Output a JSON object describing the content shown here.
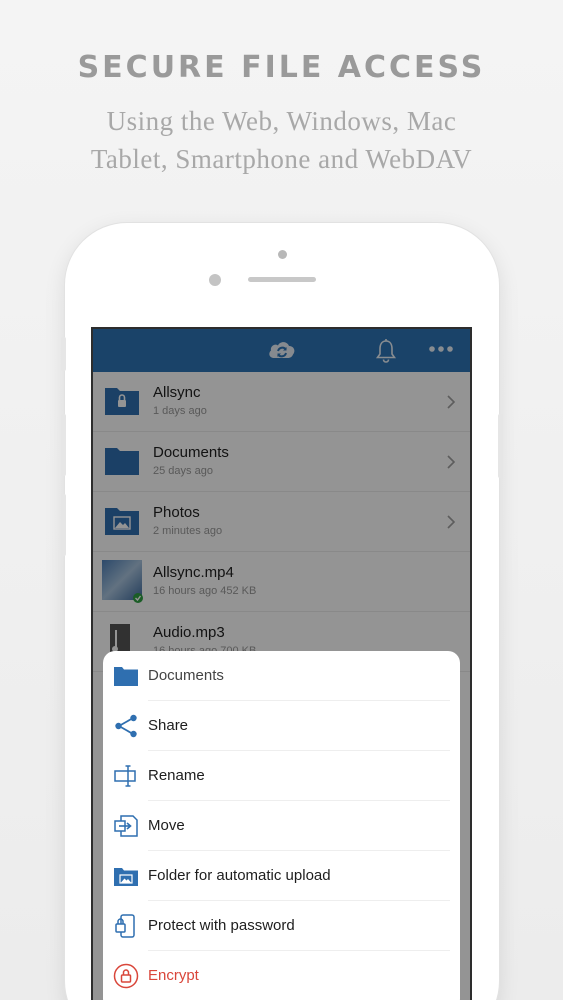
{
  "promo": {
    "headline": "SECURE FILE ACCESS",
    "subline_1": "Using the Web, Windows, Mac",
    "subline_2": "Tablet, Smartphone and WebDAV"
  },
  "colors": {
    "brand_blue": "#2e74b6",
    "folder_blue": "#2f6fb0",
    "danger_red": "#d9463a",
    "sync_green": "#2ea043"
  },
  "topbar": {
    "icons": [
      "cloud-sync-icon",
      "bell-icon",
      "more-icon"
    ]
  },
  "files": [
    {
      "name": "Allsync",
      "meta": "1 days ago",
      "icon": "locked-folder-icon",
      "chevron": true
    },
    {
      "name": "Documents",
      "meta": "25 days ago",
      "icon": "folder-icon",
      "chevron": true
    },
    {
      "name": "Photos",
      "meta": "2 minutes ago",
      "icon": "image-folder-icon",
      "chevron": true
    },
    {
      "name": "Allsync.mp4",
      "meta": "16 hours ago 452 KB",
      "icon": "video-thumbnail",
      "chevron": false
    },
    {
      "name": "Audio.mp3",
      "meta": "16 hours ago 700 KB",
      "icon": "audio-file-icon",
      "chevron": false
    }
  ],
  "action_sheet": {
    "title": "Documents",
    "actions": [
      {
        "label": "Share",
        "icon": "share-icon"
      },
      {
        "label": "Rename",
        "icon": "rename-icon"
      },
      {
        "label": "Move",
        "icon": "move-icon"
      },
      {
        "label": "Folder for automatic upload",
        "icon": "auto-upload-folder-icon"
      },
      {
        "label": "Protect with password",
        "icon": "password-protect-icon"
      },
      {
        "label": "Encrypt",
        "icon": "lock-icon"
      }
    ]
  }
}
